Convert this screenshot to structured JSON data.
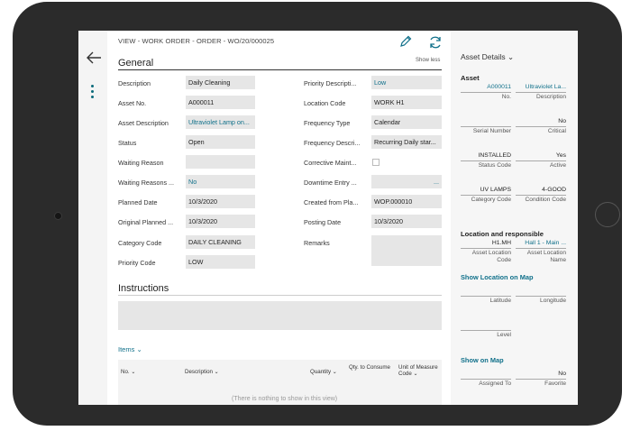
{
  "breadcrumb": "VIEW - WORK ORDER - ORDER - WO/20/000025",
  "actions": {
    "show_less": "Show less"
  },
  "general": {
    "title": "General",
    "left": [
      {
        "label": "Description",
        "value": "Daily Cleaning"
      },
      {
        "label": "Asset No.",
        "value": "A000011"
      },
      {
        "label": "Asset Description",
        "value": "Ultraviolet Lamp on..."
      },
      {
        "label": "Status",
        "value": "Open"
      },
      {
        "label": "Waiting Reason",
        "value": ""
      },
      {
        "label": "Waiting Reasons ...",
        "value": "No"
      },
      {
        "label": "Planned Date",
        "value": "10/3/2020"
      },
      {
        "label": "Original Planned ...",
        "value": "10/3/2020"
      },
      {
        "label": "Category Code",
        "value": "DAILY CLEANING"
      },
      {
        "label": "Priority Code",
        "value": "LOW"
      }
    ],
    "right": [
      {
        "label": "Priority Descripti...",
        "value": "Low"
      },
      {
        "label": "Location Code",
        "value": "WORK H1"
      },
      {
        "label": "Frequency Type",
        "value": "Calendar"
      },
      {
        "label": "Frequency Descri...",
        "value": "Recurring Daily star..."
      },
      {
        "label": "Corrective Maint...",
        "value": ""
      },
      {
        "label": "Downtime Entry ...",
        "value": "..."
      },
      {
        "label": "Created from Pla...",
        "value": "WOP.000010"
      },
      {
        "label": "Posting Date",
        "value": "10/3/2020"
      },
      {
        "label": "Remarks",
        "value": ""
      }
    ]
  },
  "instructions": {
    "title": "Instructions"
  },
  "items": {
    "title": "Items",
    "columns": [
      "No.",
      "Description",
      "Quantity",
      "Qty. to Consume",
      "Unit of Measure Code"
    ],
    "empty_text": "(There is nothing to show in this view)"
  },
  "factbox": {
    "title": "Asset Details",
    "asset_heading": "Asset",
    "rows": [
      [
        {
          "value": "A000011",
          "label": "No.",
          "link": true
        },
        {
          "value": "Ultraviolet La...",
          "label": "Description",
          "link": true
        }
      ],
      [
        {
          "value": "",
          "label": "Serial Number"
        },
        {
          "value": "No",
          "label": "Critical"
        }
      ],
      [
        {
          "value": "INSTALLED",
          "label": "Status Code"
        },
        {
          "value": "Yes",
          "label": "Active"
        }
      ],
      [
        {
          "value": "UV LAMPS",
          "label": "Category Code"
        },
        {
          "value": "4-GOOD",
          "label": "Condition Code"
        }
      ]
    ],
    "location_heading": "Location and responsible",
    "location_row": [
      {
        "value": "H1.MH",
        "label": "Asset Location Code"
      },
      {
        "value": "Hall 1 - Main ...",
        "label": "Asset Location Name",
        "link": true
      }
    ],
    "show_location": "Show Location on Map",
    "map_rows": [
      [
        {
          "value": "",
          "label": "Latitude"
        },
        {
          "value": "",
          "label": "Longitude"
        }
      ],
      [
        {
          "value": "",
          "label": "Level"
        }
      ]
    ],
    "show_map": "Show on Map",
    "assign_row": [
      {
        "value": "",
        "label": "Assigned To"
      },
      {
        "value": "No",
        "label": "Favorite"
      }
    ]
  },
  "colors": {
    "accent": "#10708a",
    "frame": "#2b2b2b",
    "field_bg": "#e6e6e6"
  },
  "icons": [
    "back-arrow-icon",
    "more-dots-icon",
    "edit-pencil-icon",
    "refresh-icon",
    "chevron-down-icon"
  ]
}
